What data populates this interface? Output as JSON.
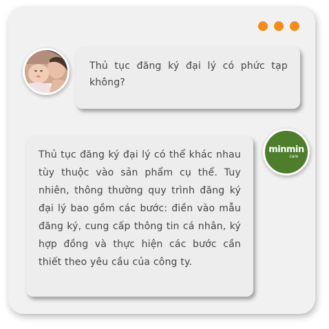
{
  "window": {
    "dots": [
      "orange-dot",
      "orange-dot",
      "orange-dot"
    ],
    "accent_color": "#f28c1b",
    "background_color": "#f1f1f1"
  },
  "chat": {
    "question": {
      "avatar": "mother-and-baby-photo",
      "text": "Thủ tục đăng ký đại lý có phức tạp không?"
    },
    "answer": {
      "avatar": {
        "brand": "minmin",
        "sub": "care",
        "color": "#4e7d2c"
      },
      "text": "Thủ tục đăng ký đại lý có thể khác nhau tùy thuộc vào sản phẩm cụ thể. Tuy nhiên, thông thường quy trình đăng ký đại lý bao gồm các bước: điền vào mẫu đăng ký, cung cấp thông tin cá nhân, ký hợp đồng và thực hiện các bước cần thiết theo yêu cầu của công ty."
    }
  }
}
